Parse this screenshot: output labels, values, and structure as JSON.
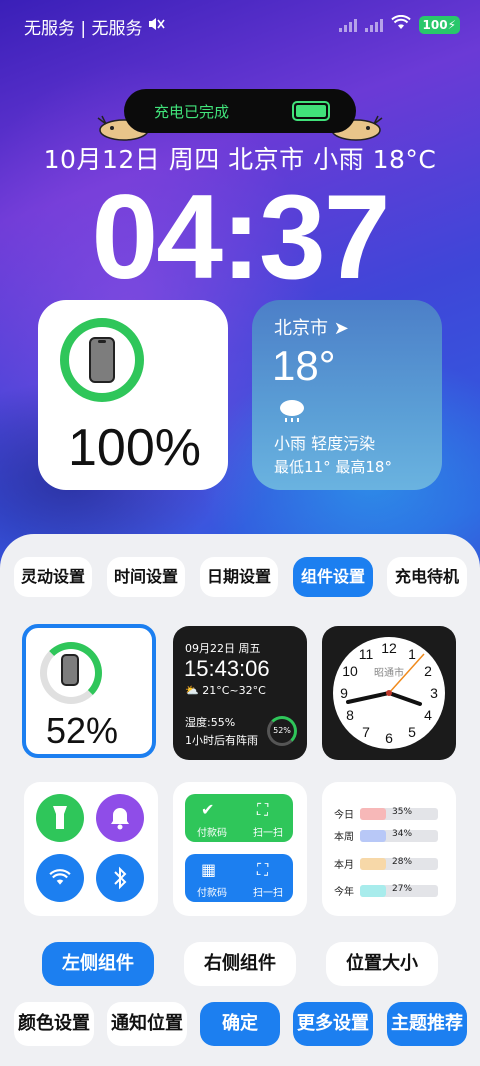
{
  "status": {
    "carrier": "无服务 | 无服务",
    "battery": "100"
  },
  "island": {
    "text": "充电已完成"
  },
  "lockscreen": {
    "dateline": "10月12日 周四 北京市  小雨  18°C",
    "clock": "04:37"
  },
  "battery_widget": {
    "percent": "100%",
    "level": 1.0
  },
  "weather_widget": {
    "city": "北京市",
    "temp": "18°",
    "condition": "小雨 轻度污染",
    "range": "最低11°  最高18°"
  },
  "tabs": [
    {
      "label": "灵动设置"
    },
    {
      "label": "时间设置"
    },
    {
      "label": "日期设置"
    },
    {
      "label": "组件设置",
      "active": true
    },
    {
      "label": "充电待机"
    }
  ],
  "widgets": {
    "battery_card": {
      "percent": "52%",
      "level": 0.52
    },
    "info_card": {
      "date": "09月22日 周五",
      "time": "15:43:06",
      "weather": "21°C~32°C",
      "humidity": "湿度:55%",
      "rain": "1小时后有阵雨",
      "ring": "52%"
    },
    "clock_card": {
      "city": "昭通市",
      "numerals": [
        "12",
        "1",
        "2",
        "3",
        "4",
        "5",
        "6",
        "7",
        "8",
        "9",
        "10",
        "11"
      ]
    },
    "pay_card": {
      "pay": "付款码",
      "scan": "扫一扫"
    },
    "stats_card": {
      "rows": [
        {
          "label": "今日",
          "value": "35%",
          "color": "#f7b8b8"
        },
        {
          "label": "本周",
          "value": "34%",
          "color": "#b8c8f7"
        },
        {
          "label": "本月",
          "value": "28%",
          "color": "#f7d8a8"
        },
        {
          "label": "今年",
          "value": "27%",
          "color": "#a8ecec"
        }
      ]
    }
  },
  "buttons": {
    "left": "左侧组件",
    "right": "右侧组件",
    "size": "位置大小",
    "color": "颜色设置",
    "notify": "通知位置",
    "ok": "确定",
    "more": "更多设置",
    "theme": "主题推荐"
  },
  "colors": {
    "accent": "#1c7ff0",
    "green": "#2fc65a",
    "purple": "#8f4de8"
  }
}
